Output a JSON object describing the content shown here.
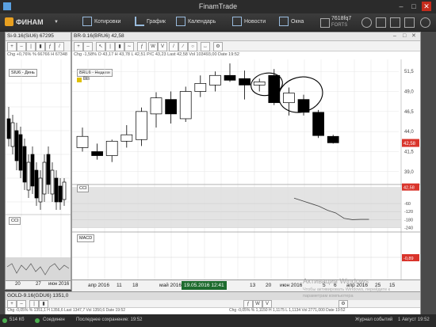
{
  "window": {
    "title": "FinamTrade"
  },
  "toolbar": {
    "logo": "ФИНАМ",
    "quotes": "Котировки",
    "chart": "График",
    "calendar": "Календарь",
    "news": "Новости",
    "windows": "Окна",
    "account": "7618fq7",
    "account_sub": "FORTS"
  },
  "left_panel": {
    "title": "Si-9.16(SiU6) 67295",
    "info": "Chg +0,76%  % 66766  H 67348",
    "legend": "SIU6 - День",
    "cci_label": "CCI",
    "x_ticks": [
      "20",
      "27",
      "июн 2016"
    ]
  },
  "main_panel": {
    "title": "BR-9.16(BRU6) 42,58",
    "info": "Chg -1,58%  O 43,17  H 43,78  L 42,51  P/C 43,23  Last 42,58  Vol 103493,00  Date 19:52",
    "legend": "BRU6 - Неделя",
    "bb_label": "BB",
    "cci_label": "CCI",
    "macd_label": "MACD",
    "price_ticks": [
      "51,5",
      "49,0",
      "46,5",
      "44,0",
      "41,5",
      "39,0"
    ],
    "price_tag": "42,58",
    "cci_ticks": [
      "60",
      "-60",
      "-120",
      "-180",
      "-240"
    ],
    "cci_tag": "42,58",
    "macd_tag": "-0,89",
    "x_ticks": [
      "апр 2016",
      "11",
      "18",
      "май 2016",
      "9",
      "16",
      "13",
      "20",
      "июн 2016",
      "5",
      "6",
      "апр 2016",
      "25",
      "15"
    ],
    "cursor_date": "19.05.2016 12:41"
  },
  "bottom_panel": {
    "title": "GOLD-9.16(GDU6) 1351,0",
    "info": "Chg -0,05%  % 1351,1  H 1356,6  Last 1347,7  Vol 1350,6  Date 19:52"
  },
  "bottom_right_info": "Chg -0,05%  % 1,1150  H 1,1175  L 1,1134  Vol 2771,000  Date 19:52",
  "watermark": {
    "line1": "Активация Windows",
    "line2": "Чтобы активировать Windows, перейдите к",
    "line3": "параметрам компьютера"
  },
  "status": {
    "size": "514 Кб",
    "state": "Соединен",
    "saved": "Последнее сохранение: 19:52",
    "journal": "Журнал событий",
    "date": "1 Август 19:52"
  },
  "chart_data": [
    {
      "type": "candlestick",
      "title": "BR-9.16(BRU6) 42,58",
      "legend": "BRU6 - Неделя",
      "ylim": [
        37.5,
        53
      ],
      "y_ticks": [
        51.5,
        49.0,
        46.5,
        44.0,
        41.5,
        39.0
      ],
      "candles": [
        {
          "o": 42.0,
          "h": 44.5,
          "l": 41.5,
          "c": 43.4
        },
        {
          "o": 41.5,
          "h": 42.5,
          "l": 40.5,
          "c": 41.0
        },
        {
          "o": 41.0,
          "h": 43.0,
          "l": 40.2,
          "c": 42.8
        },
        {
          "o": 42.8,
          "h": 44.8,
          "l": 42.0,
          "c": 43.6
        },
        {
          "o": 43.0,
          "h": 47.0,
          "l": 42.2,
          "c": 46.5
        },
        {
          "o": 46.2,
          "h": 48.9,
          "l": 44.5,
          "c": 48.2
        },
        {
          "o": 48.0,
          "h": 49.0,
          "l": 45.0,
          "c": 46.2
        },
        {
          "o": 45.6,
          "h": 49.6,
          "l": 45.2,
          "c": 49.0
        },
        {
          "o": 49.0,
          "h": 51.0,
          "l": 48.3,
          "c": 50.0
        },
        {
          "o": 49.8,
          "h": 51.5,
          "l": 49.0,
          "c": 51.0
        },
        {
          "o": 51.0,
          "h": 52.5,
          "l": 50.2,
          "c": 50.4
        },
        {
          "o": 50.6,
          "h": 51.6,
          "l": 48.0,
          "c": 49.8
        },
        {
          "o": 49.8,
          "h": 50.6,
          "l": 49.0,
          "c": 50.2
        },
        {
          "o": 51.0,
          "h": 51.8,
          "l": 47.3,
          "c": 47.6
        },
        {
          "o": 47.6,
          "h": 49.5,
          "l": 46.0,
          "c": 48.8
        },
        {
          "o": 48.0,
          "h": 48.6,
          "l": 46.0,
          "c": 46.4
        },
        {
          "o": 46.4,
          "h": 46.7,
          "l": 43.2,
          "c": 43.5
        },
        {
          "o": 43.4,
          "h": 43.6,
          "l": 42.5,
          "c": 42.6
        }
      ],
      "last": 42.58
    },
    {
      "type": "line",
      "title": "CCI",
      "ylim": [
        -260,
        70
      ],
      "y_ticks": [
        60,
        -60,
        -120,
        -180,
        -240
      ],
      "values": [
        -20,
        -40,
        -60,
        -80,
        -110,
        -130,
        -170,
        -180,
        -178,
        -178
      ]
    }
  ]
}
